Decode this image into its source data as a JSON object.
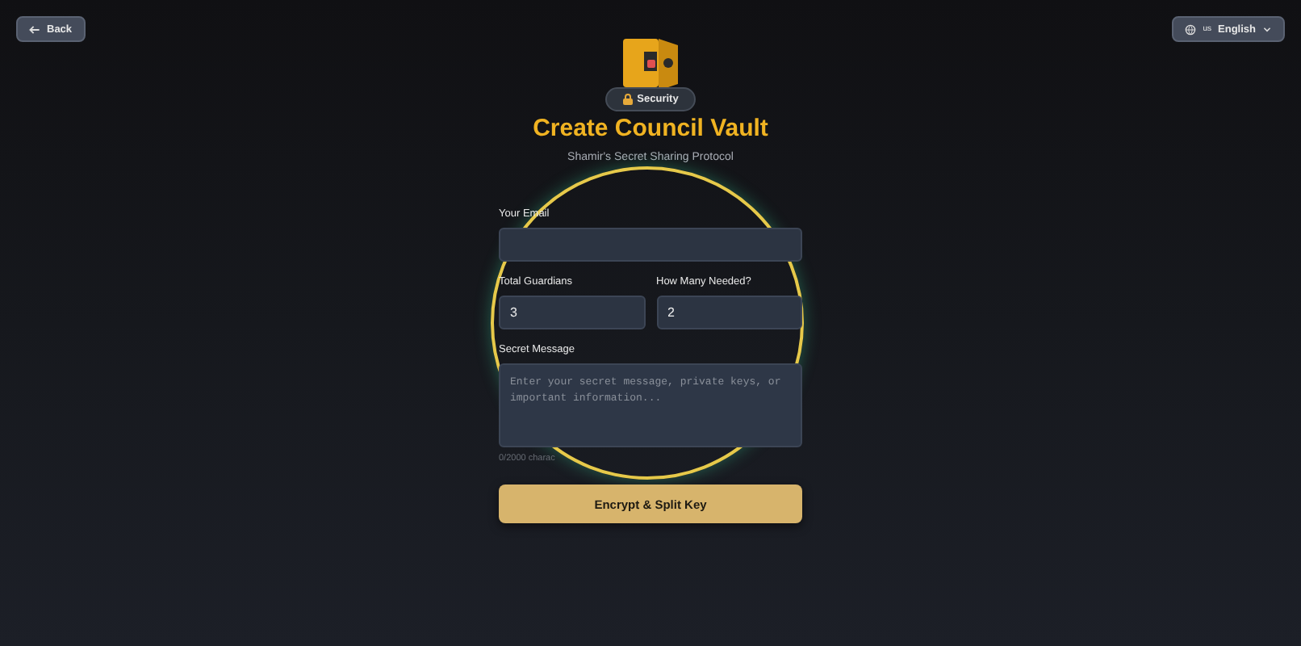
{
  "back_button": {
    "label": "Back"
  },
  "language": {
    "flag": "us",
    "label": "English"
  },
  "badge": {
    "label": "Security"
  },
  "title": "Create Council Vault",
  "subtitle": "Shamir's Secret Sharing Protocol",
  "fields": [
    {
      "kind": "text",
      "label": "Your Email"
    },
    {
      "kind": "pair",
      "items": [
        {
          "label": "Total Guardians",
          "value": "3"
        },
        {
          "label": "How Many Needed?",
          "value": "2"
        }
      ]
    },
    {
      "kind": "textarea",
      "label": "Secret Message",
      "placeholder": "Enter your secret message, private keys, or important information...",
      "counter": "0/2000 charac"
    }
  ],
  "submit": {
    "label": "Encrypt & Split Key"
  }
}
